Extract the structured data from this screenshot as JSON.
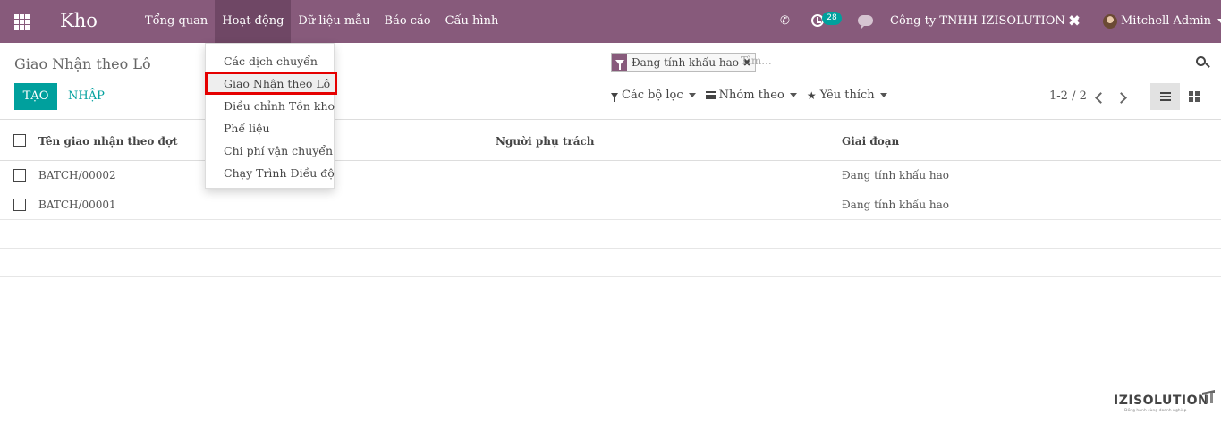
{
  "navbar": {
    "brand": "Kho",
    "menu": [
      "Tổng quan",
      "Hoạt động",
      "Dữ liệu mẫu",
      "Báo cáo",
      "Cấu hình"
    ],
    "activity_count": "28",
    "company": "Công ty TNHH IZISOLUTION",
    "user": "Mitchell Admin",
    "accent_color": "#875a7b"
  },
  "breadcrumb": "Giao Nhận theo Lô",
  "buttons": {
    "create": "TẠO",
    "import": "NHẬP"
  },
  "search": {
    "facet": "Đang tính khấu hao",
    "placeholder": "Tìm..."
  },
  "filters": {
    "filter": "Các bộ lọc",
    "group_by": "Nhóm theo",
    "favorites": "Yêu thích"
  },
  "pager": "1-2 / 2",
  "table": {
    "headers": [
      "Tên giao nhận theo đợt",
      "Người phụ trách",
      "Giai đoạn"
    ],
    "rows": [
      {
        "name": "BATCH/00002",
        "responsible": "",
        "stage": "Đang tính khấu hao"
      },
      {
        "name": "BATCH/00001",
        "responsible": "",
        "stage": "Đang tính khấu hao"
      }
    ]
  },
  "dropdown": {
    "items": [
      "Các dịch chuyển",
      "Giao Nhận theo Lô",
      "Điều chỉnh Tồn kho",
      "Phế liệu",
      "Chi phí vận chuyển",
      "Chạy Trình Điều độ"
    ],
    "active_index": 1
  },
  "logo": {
    "name": "IZISOLUTION",
    "tagline": "Đồng hành cùng doanh nghiệp"
  }
}
